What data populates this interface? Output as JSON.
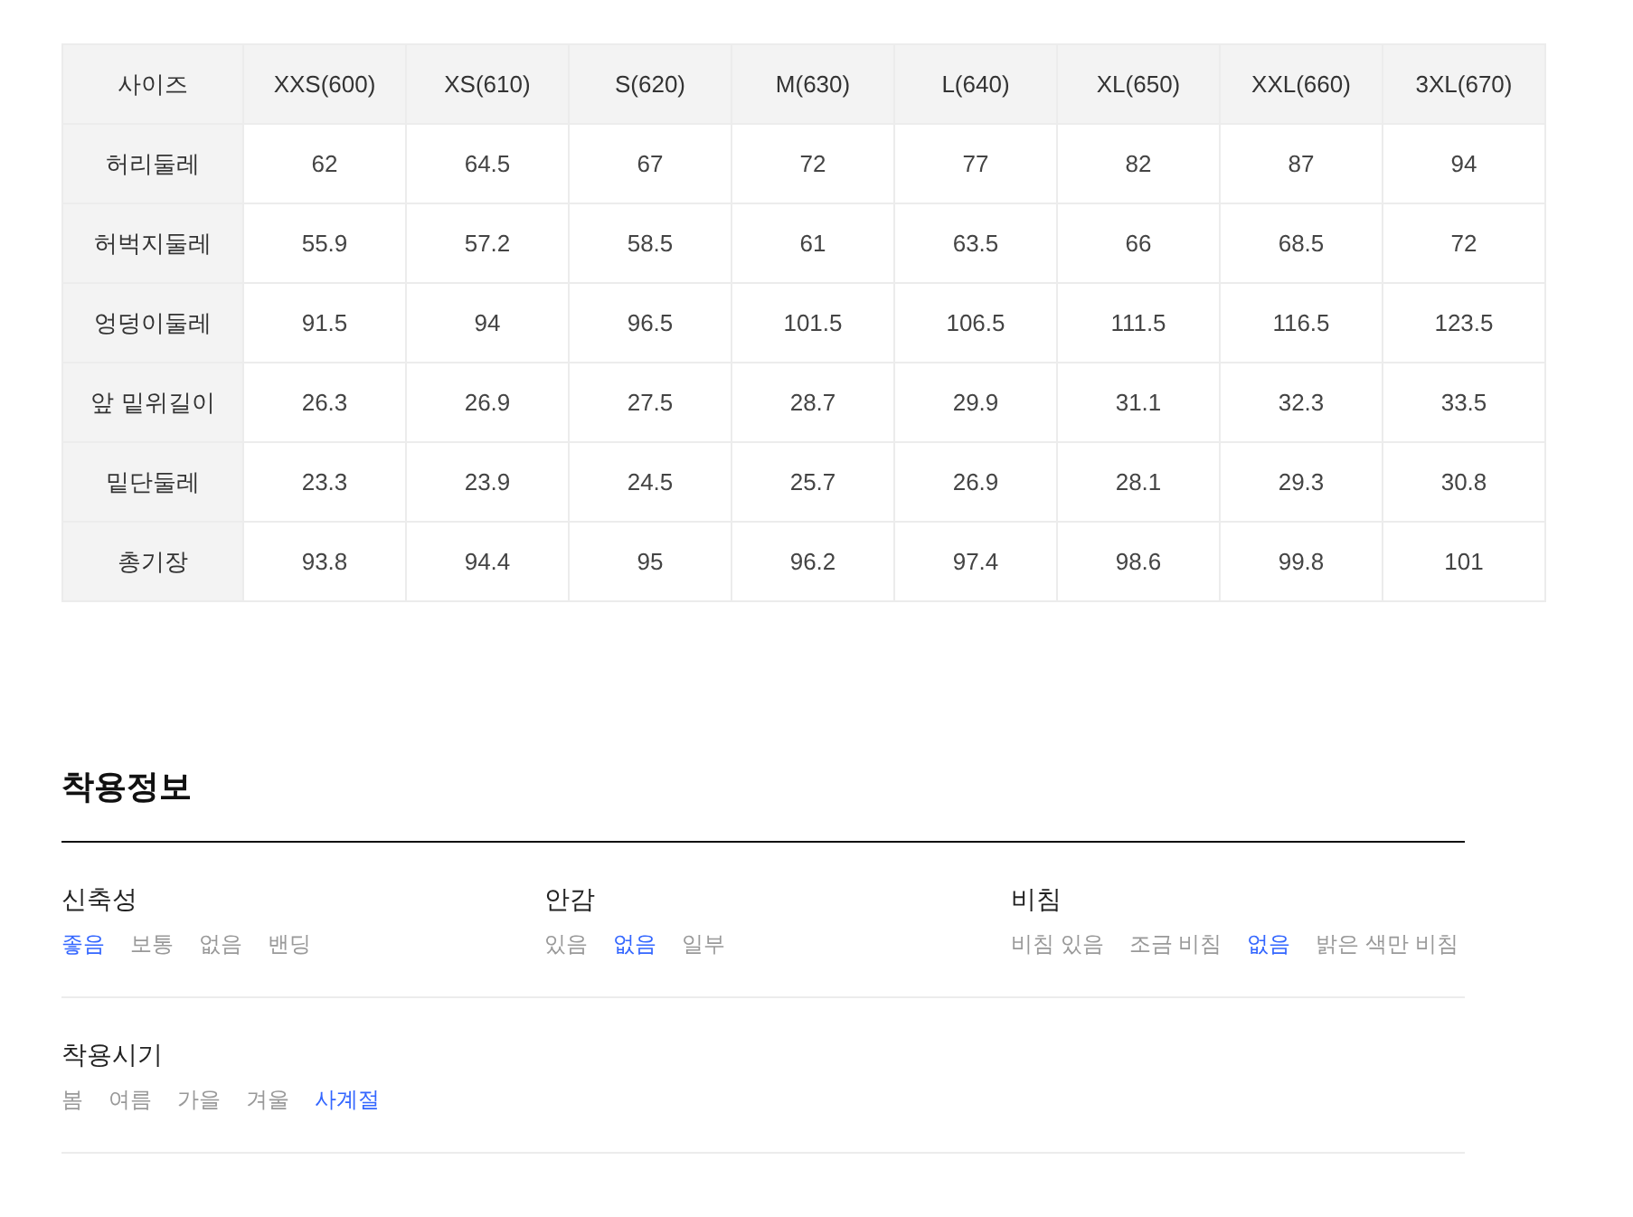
{
  "size_table": {
    "corner": "사이즈",
    "columns": [
      "XXS(600)",
      "XS(610)",
      "S(620)",
      "M(630)",
      "L(640)",
      "XL(650)",
      "XXL(660)",
      "3XL(670)"
    ],
    "rows": [
      {
        "label": "허리둘레",
        "values": [
          "62",
          "64.5",
          "67",
          "72",
          "77",
          "82",
          "87",
          "94"
        ]
      },
      {
        "label": "허벅지둘레",
        "values": [
          "55.9",
          "57.2",
          "58.5",
          "61",
          "63.5",
          "66",
          "68.5",
          "72"
        ]
      },
      {
        "label": "엉덩이둘레",
        "values": [
          "91.5",
          "94",
          "96.5",
          "101.5",
          "106.5",
          "111.5",
          "116.5",
          "123.5"
        ]
      },
      {
        "label": "앞 밑위길이",
        "values": [
          "26.3",
          "26.9",
          "27.5",
          "28.7",
          "29.9",
          "31.1",
          "32.3",
          "33.5"
        ]
      },
      {
        "label": "밑단둘레",
        "values": [
          "23.3",
          "23.9",
          "24.5",
          "25.7",
          "26.9",
          "28.1",
          "29.3",
          "30.8"
        ]
      },
      {
        "label": "총기장",
        "values": [
          "93.8",
          "94.4",
          "95",
          "96.2",
          "97.4",
          "98.6",
          "99.8",
          "101"
        ]
      }
    ]
  },
  "fit_info": {
    "title": "착용정보",
    "sections": [
      {
        "items": [
          {
            "label": "신축성",
            "options": [
              {
                "label": "좋음",
                "selected": true
              },
              {
                "label": "보통",
                "selected": false
              },
              {
                "label": "없음",
                "selected": false
              },
              {
                "label": "밴딩",
                "selected": false
              }
            ]
          },
          {
            "label": "안감",
            "options": [
              {
                "label": "있음",
                "selected": false
              },
              {
                "label": "없음",
                "selected": true
              },
              {
                "label": "일부",
                "selected": false
              }
            ]
          },
          {
            "label": "비침",
            "options": [
              {
                "label": "비침 있음",
                "selected": false
              },
              {
                "label": "조금 비침",
                "selected": false
              },
              {
                "label": "없음",
                "selected": true
              },
              {
                "label": "밝은 색만 비침",
                "selected": false
              }
            ]
          }
        ]
      },
      {
        "items": [
          {
            "label": "착용시기",
            "options": [
              {
                "label": "봄",
                "selected": false
              },
              {
                "label": "여름",
                "selected": false
              },
              {
                "label": "가을",
                "selected": false
              },
              {
                "label": "겨울",
                "selected": false
              },
              {
                "label": "사계절",
                "selected": true
              }
            ]
          }
        ]
      }
    ]
  }
}
